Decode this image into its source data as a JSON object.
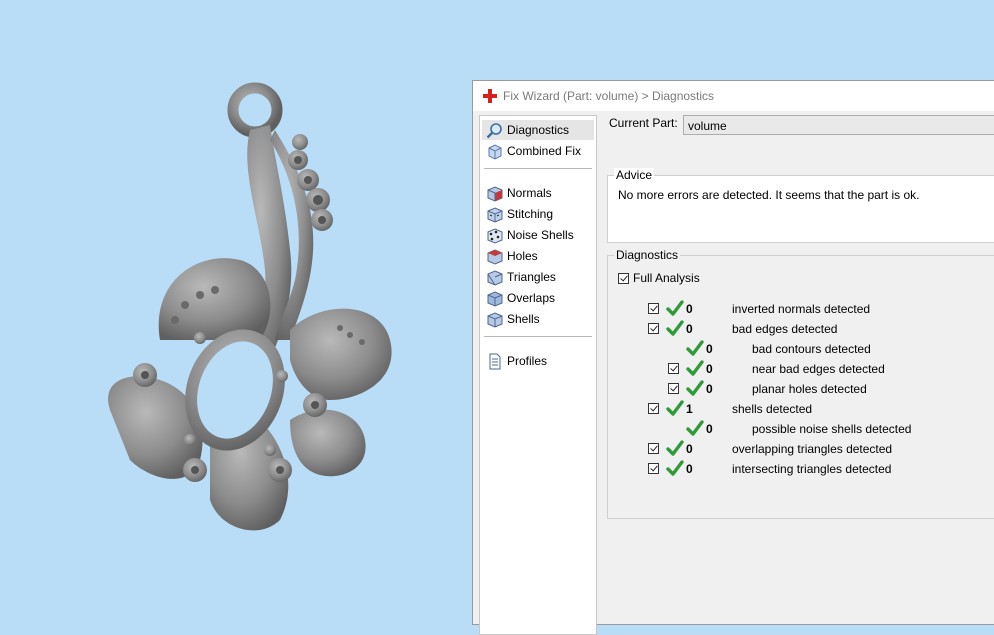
{
  "window": {
    "title": "Fix Wizard (Part: volume) > Diagnostics"
  },
  "nav": {
    "items": [
      {
        "label": "Diagnostics",
        "icon": "magnifier-icon",
        "active": true
      },
      {
        "label": "Combined Fix",
        "icon": "combined-fix-icon"
      },
      {
        "label": "Normals",
        "icon": "normals-cube-icon"
      },
      {
        "label": "Stitching",
        "icon": "stitching-cube-icon"
      },
      {
        "label": "Noise Shells",
        "icon": "noise-shells-icon"
      },
      {
        "label": "Holes",
        "icon": "holes-cube-icon"
      },
      {
        "label": "Triangles",
        "icon": "triangles-cube-icon"
      },
      {
        "label": "Overlaps",
        "icon": "overlaps-cube-icon"
      },
      {
        "label": "Shells",
        "icon": "shells-cube-icon"
      },
      {
        "label": "Profiles",
        "icon": "profiles-document-icon"
      }
    ]
  },
  "current_part": {
    "label": "Current Part:",
    "value": "volume"
  },
  "advice": {
    "title": "Advice",
    "text": "No more errors are detected. It seems that the part is ok."
  },
  "diagnostics": {
    "title": "Diagnostics",
    "full_analysis": {
      "label": "Full Analysis",
      "checked": true
    },
    "rows": [
      {
        "count": "0",
        "label": "inverted normals detected",
        "checkbox": true,
        "indent": 0
      },
      {
        "count": "0",
        "label": "bad edges detected",
        "checkbox": true,
        "indent": 0
      },
      {
        "count": "0",
        "label": "bad contours detected",
        "checkbox": false,
        "indent": 1
      },
      {
        "count": "0",
        "label": "near bad edges detected",
        "checkbox": true,
        "indent": 1
      },
      {
        "count": "0",
        "label": "planar holes detected",
        "checkbox": true,
        "indent": 1
      },
      {
        "count": "1",
        "label": "shells detected",
        "checkbox": true,
        "indent": 0
      },
      {
        "count": "0",
        "label": "possible noise shells detected",
        "checkbox": false,
        "indent": 1
      },
      {
        "count": "0",
        "label": "overlapping triangles detected",
        "checkbox": true,
        "indent": 0
      },
      {
        "count": "0",
        "label": "intersecting triangles detected",
        "checkbox": true,
        "indent": 0
      }
    ]
  },
  "colors": {
    "background": "#b9dcf7",
    "model": "#8a8a8a",
    "check": "#2f9a3a",
    "title_cross": "#d81e1e"
  }
}
